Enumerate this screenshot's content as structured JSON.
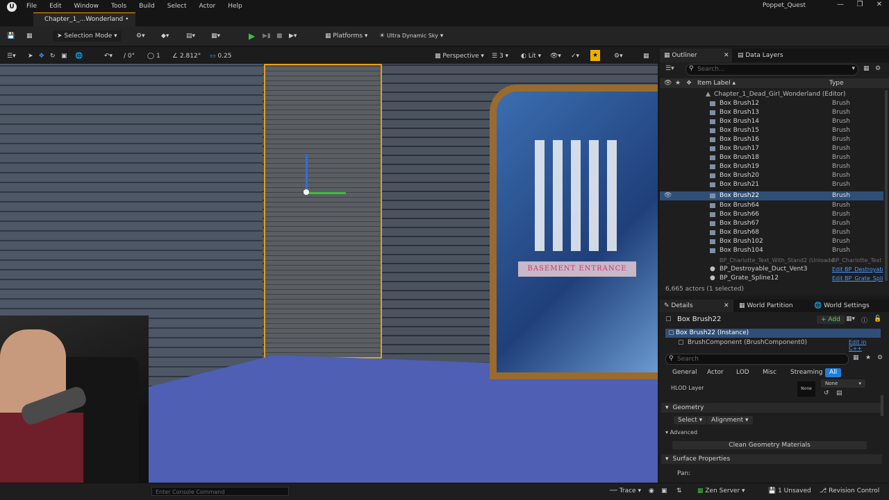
{
  "menu": {
    "items": [
      "File",
      "Edit",
      "Window",
      "Tools",
      "Build",
      "Select",
      "Actor",
      "Help"
    ],
    "project": "Poppet_Quest"
  },
  "tab": {
    "level": "Chapter_1_...Wonderland •"
  },
  "toolbar": {
    "mode": "Selection Mode",
    "platforms": "Platforms",
    "sky": "Ultra Dynamic Sky"
  },
  "viewport_toolbar": {
    "rotation_snap": "0°",
    "scale_snap_count": "1",
    "grid_size": "2.812°",
    "scale_value": "0.25",
    "view_mode": "Perspective",
    "lit": "Lit",
    "camera_speed": "3"
  },
  "scene": {
    "sign_text": "BASEMENT ENTRANCE"
  },
  "outliner": {
    "tab": "Outliner",
    "tab2": "Data Layers",
    "search_placeholder": "Search...",
    "col_label": "Item Label ▴",
    "col_type": "Type",
    "root": "Chapter_1_Dead_Girl_Wonderland (Editor)",
    "rows": [
      {
        "label": "Box Brush12",
        "type": "Brush"
      },
      {
        "label": "Box Brush13",
        "type": "Brush"
      },
      {
        "label": "Box Brush14",
        "type": "Brush"
      },
      {
        "label": "Box Brush15",
        "type": "Brush"
      },
      {
        "label": "Box Brush16",
        "type": "Brush"
      },
      {
        "label": "Box Brush17",
        "type": "Brush"
      },
      {
        "label": "Box Brush18",
        "type": "Brush"
      },
      {
        "label": "Box Brush19",
        "type": "Brush"
      },
      {
        "label": "Box Brush20",
        "type": "Brush"
      },
      {
        "label": "Box Brush21",
        "type": "Brush"
      },
      {
        "label": "Box Brush22",
        "type": "Brush"
      },
      {
        "label": "Box Brush64",
        "type": "Brush"
      },
      {
        "label": "Box Brush66",
        "type": "Brush"
      },
      {
        "label": "Box Brush67",
        "type": "Brush"
      },
      {
        "label": "Box Brush68",
        "type": "Brush"
      },
      {
        "label": "Box Brush102",
        "type": "Brush"
      },
      {
        "label": "Box Brush104",
        "type": "Brush"
      },
      {
        "label": "BP_Charlotte_Text_With_Stand2 (Unloade",
        "type": "BP_Charlotte_Text"
      },
      {
        "label": "BP_Destroyable_Duct_Vent3",
        "type": "Edit BP_Destroyab"
      },
      {
        "label": "BP_Grate_Spline12",
        "type": "Edit BP_Grate_Spli"
      }
    ],
    "footer": "6,665 actors (1 selected)"
  },
  "details": {
    "tab": "Details",
    "tab2": "World Partition",
    "tab3": "World Settings",
    "actor_name": "Box Brush22",
    "add_label": "+ Add",
    "instance": "Box Brush22 (Instance)",
    "component": "BrushComponent (BrushComponent0)",
    "edit_cpp": "Edit in C++",
    "search_placeholder": "Search",
    "filters": [
      "General",
      "Actor",
      "LOD",
      "Misc",
      "Streaming",
      "All"
    ],
    "hlod_label": "HLOD Layer",
    "hlod_value": "None",
    "hlod_dropdown": "None",
    "geometry": "Geometry",
    "select_label": "Select",
    "alignment_label": "Alignment",
    "advanced": "Advanced",
    "clean_label": "Clean Geometry Materials",
    "surface": "Surface Properties",
    "pan": "Pan:"
  },
  "bottom": {
    "console_placeholder": "Enter Console Command",
    "trace": "Trace",
    "zen": "Zen Server",
    "unsaved": "1 Unsaved",
    "revision": "Revision Control"
  }
}
